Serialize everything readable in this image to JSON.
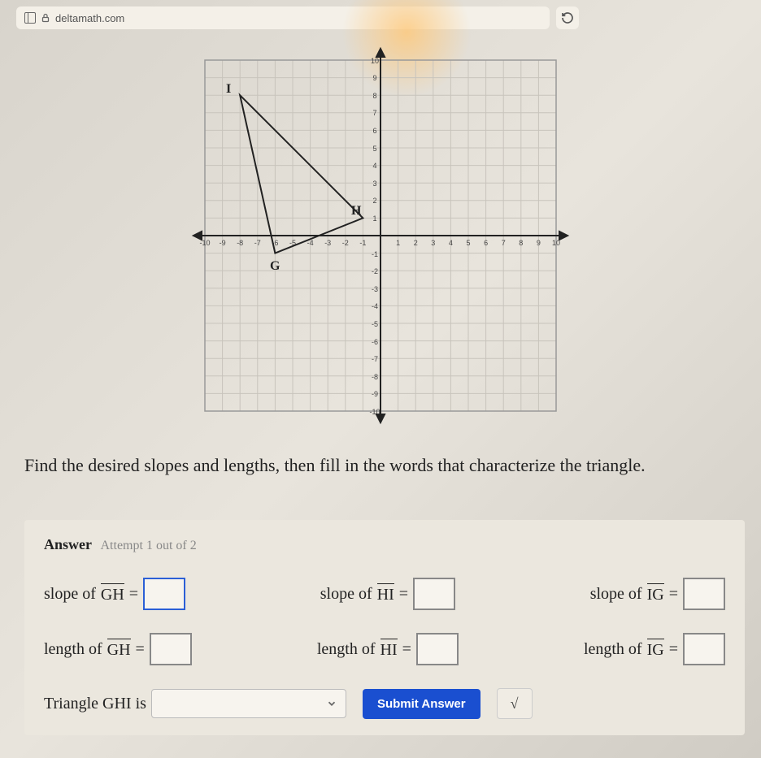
{
  "addressbar": {
    "domain": "deltamath.com"
  },
  "chart_data": {
    "type": "scatter",
    "title": "",
    "xlabel": "",
    "ylabel": "",
    "xlim": [
      -10,
      10
    ],
    "ylim": [
      -10,
      10
    ],
    "points": [
      {
        "name": "G",
        "x": -6,
        "y": -1
      },
      {
        "name": "H",
        "x": -1,
        "y": 1
      },
      {
        "name": "I",
        "x": -8,
        "y": 8
      }
    ],
    "segments": [
      [
        "G",
        "H"
      ],
      [
        "H",
        "I"
      ],
      [
        "I",
        "G"
      ]
    ],
    "grid": true
  },
  "labels": {
    "G": "G",
    "H": "H",
    "I": "I"
  },
  "question": "Find the desired slopes and lengths, then fill in the words that characterize the triangle.",
  "answer": {
    "heading": "Answer",
    "attempt": "Attempt 1 out of 2",
    "slope_prefix": "slope of",
    "length_prefix": "length of",
    "eq": "=",
    "seg_GH": "GH",
    "seg_HI": "HI",
    "seg_IG": "IG",
    "triangle_prefix": "Triangle GHI is",
    "submit": "Submit Answer",
    "sqrt_glyph": "√"
  }
}
